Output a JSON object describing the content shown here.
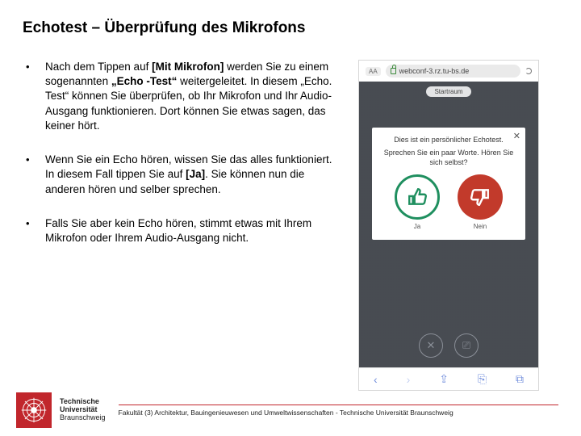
{
  "title": "Echotest – Überprüfung des Mikrofons",
  "bullets": {
    "b1_1": "Nach dem Tippen auf ",
    "b1_2": "[Mit Mikrofon]",
    "b1_3": " werden Sie zu einem sogenannten ",
    "b1_4": "„Echo -Test“",
    "b1_5": " weitergeleitet. In diesem „Echo. Test“ können Sie überprüfen, ob Ihr Mikrofon und Ihr Audio-Ausgang funktionieren. Dort können Sie etwas sagen, das keiner hört.",
    "b2_1": "Wenn Sie ein Echo hören, wissen Sie das alles funktioniert. In diesem Fall tippen Sie auf ",
    "b2_2": "[Ja]",
    "b2_3": ". Sie können nun die anderen hören und selber sprechen.",
    "b3": "Falls Sie aber kein Echo hören, stimmt etwas mit Ihrem Mikrofon oder Ihrem Audio-Ausgang nicht."
  },
  "phone": {
    "aa": "AA",
    "url": "webconf-3.rz.tu-bs.de",
    "room": "Startraum",
    "modal_title": "Dies ist ein persönlicher Echotest.",
    "modal_line1": "Sprechen Sie ein paar Worte. Hören Sie",
    "modal_line2": "sich selbst?",
    "close": "✕",
    "yes": "Ja",
    "no": "Nein",
    "bb1": "✕",
    "bb2": "⎚",
    "nav_back": "‹",
    "nav_fwd": "›",
    "nav_share": "⇪",
    "nav_book": "⎘",
    "nav_tabs": "⧉"
  },
  "footer": {
    "uni1": "Technische",
    "uni2": "Universität",
    "uni3": "Braunschweig",
    "text": "Fakultät (3) Architektur, Bauingenieuwesen und Umweltwissenschaften  -  Technische Universität Braunschweig"
  }
}
